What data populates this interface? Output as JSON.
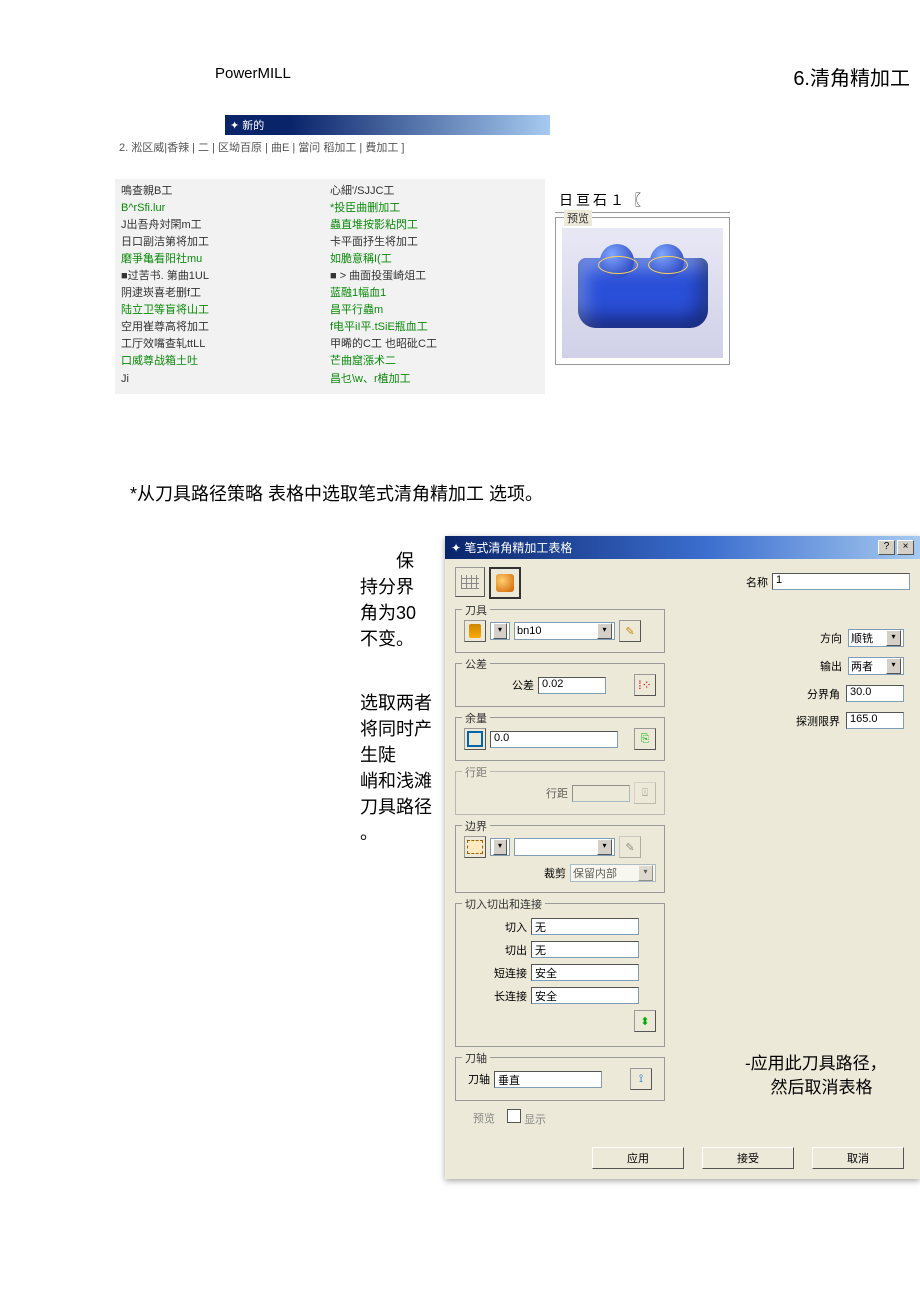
{
  "header": {
    "left": "PowerMILL",
    "right": "6.清角精加工"
  },
  "strategy_panel": {
    "title": "新的",
    "tabs": "2. 淞区威|香辣 | 二 | 区坳百原 | 曲E  | 當问  稻加工 | 費加工 ]",
    "col_left": [
      {
        "t": "鳴查親B工",
        "c": "dark"
      },
      {
        "t": "B^rSfi.lur",
        "c": "green"
      },
      {
        "t": "J出吾舟対閑m工",
        "c": "dark"
      },
      {
        "t": "日口副洁第将加工",
        "c": "dark"
      },
      {
        "t": "磨爭亀看阳社mu",
        "c": "green"
      },
      {
        "t": "■过苦书. 第曲1UL",
        "c": "dark"
      },
      {
        "t": "阴逮崁喜老删f工",
        "c": "dark"
      },
      {
        "t": "陆立卫等盲将山工",
        "c": "green"
      },
      {
        "t": "空用崔尊高将加工",
        "c": "dark"
      },
      {
        "t": "工厅效嘴查轧ttLL",
        "c": "dark"
      },
      {
        "t": "口威尊战箱土吐",
        "c": "green"
      },
      {
        "t": "Ji",
        "c": "dark"
      }
    ],
    "col_right": [
      {
        "t": "心細'/SJJC工",
        "c": "dark"
      },
      {
        "t": "*投臣曲删加工",
        "c": "green"
      },
      {
        "t": "蟲直堆按影粘閃工",
        "c": "green"
      },
      {
        "t": "卡平面抒生将加工",
        "c": "dark"
      },
      {
        "t": "如脆意稱I(工",
        "c": "green"
      },
      {
        "t": "■ > 曲面投蛋崎俎工",
        "c": "dark"
      },
      {
        "t": "蓝融1幅血1",
        "c": "green"
      },
      {
        "t": "昌平行蟲m",
        "c": "green"
      },
      {
        "t": "f电平iI平.tSiE瓶血工",
        "c": "green"
      },
      {
        "t": "甲晞的C工 也昭砒C工",
        "c": "dark"
      },
      {
        "t": "芒曲窟漲术二",
        "c": "green"
      },
      {
        "t": "昌乜\\w、r植加工",
        "c": "green"
      }
    ]
  },
  "preview": {
    "top": "日亘石１〖",
    "legend": "预览"
  },
  "instruction": "*从刀具路径策略  表格中选取笔式清角精加工  选项。",
  "note1": [
    "保",
    "持分界",
    "角为30",
    "不变。"
  ],
  "note2": [
    "选取两者",
    "将同时产",
    "生陡",
    "峭和浅滩",
    "刀具路径",
    "。"
  ],
  "dialog": {
    "title": "笔式清角精加工表格",
    "name_label": "名称",
    "name_value": "1",
    "groups": {
      "tool": {
        "legend": "刀具",
        "value": "bn10"
      },
      "tolerance": {
        "legend": "公差",
        "label": "公差",
        "value": "0.02"
      },
      "allowance": {
        "legend": "余量",
        "value": "0.0"
      },
      "stepover": {
        "legend": "行距",
        "label": "行距",
        "value": ""
      },
      "boundary": {
        "legend": "边界",
        "trim_label": "裁剪",
        "trim_value": "保留内部"
      },
      "leads": {
        "legend": "切入切出和连接",
        "rows": [
          {
            "l": "切入",
            "v": "无"
          },
          {
            "l": "切出",
            "v": "无"
          },
          {
            "l": "短连接",
            "v": "安全"
          },
          {
            "l": "长连接",
            "v": "安全"
          }
        ]
      },
      "axis": {
        "legend": "刀轴",
        "label": "刀轴",
        "value": "垂直"
      }
    },
    "right": {
      "dir_label": "方向",
      "dir_value": "顺铣",
      "out_label": "输出",
      "out_value": "两者",
      "angle_label": "分界角",
      "angle_value": "30.0",
      "detect_label": "探测限界",
      "detect_value": "165.0"
    },
    "preview_btn": "预览",
    "show_label": "显示",
    "buttons": {
      "apply": "应用",
      "accept": "接受",
      "cancel": "取消"
    }
  },
  "apply_note": [
    "-应用此刀具路径，",
    "然后取消表格"
  ]
}
